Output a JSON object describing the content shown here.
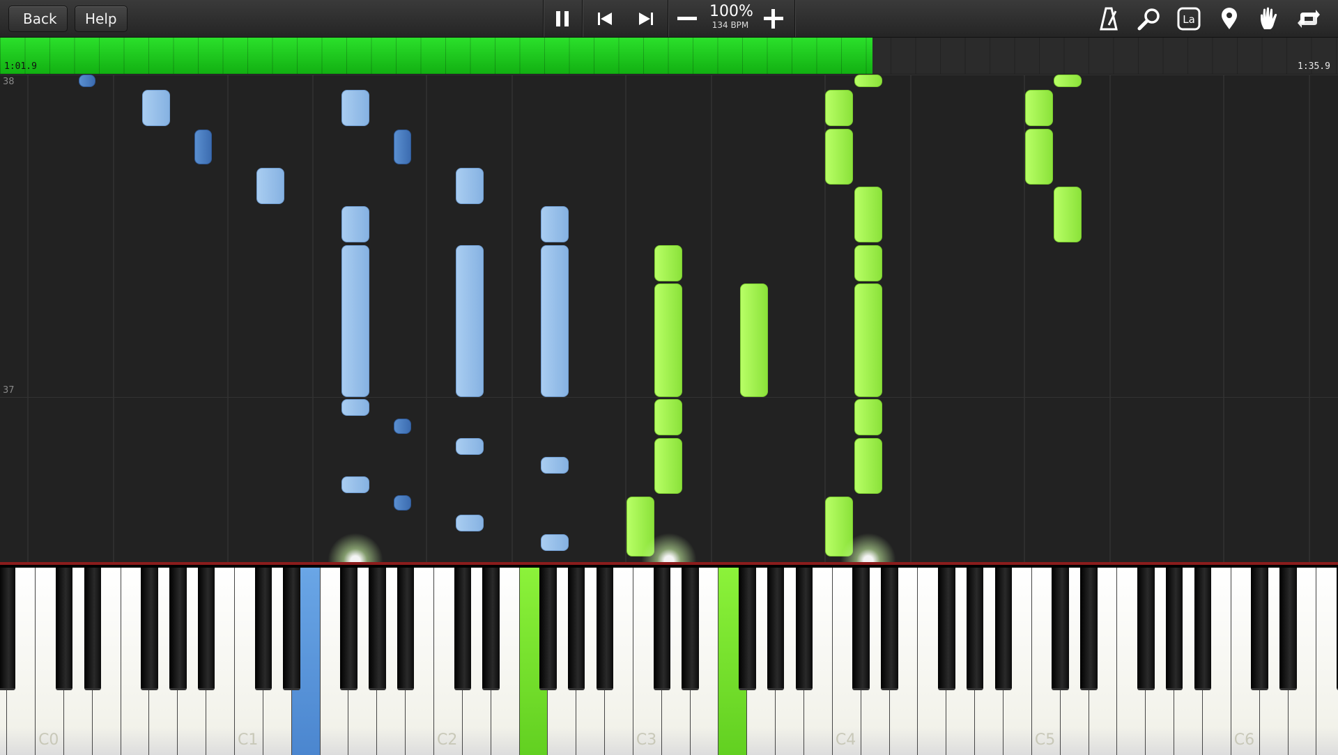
{
  "toolbar": {
    "back_label": "Back",
    "help_label": "Help",
    "speed_percent": "100%",
    "speed_bpm": "134 BPM",
    "icons": [
      "pause-icon",
      "skip-back-icon",
      "skip-forward-icon",
      "minus-icon",
      "plus-icon",
      "metronome-icon",
      "magnifier-icon",
      "note-label-icon",
      "location-pin-icon",
      "hand-icon",
      "loop-icon"
    ],
    "note_label_text": "La"
  },
  "progress": {
    "time_elapsed": "1:01.9",
    "time_total": "1:35.9",
    "fraction": 0.652,
    "fill_color": "#1dc41d"
  },
  "roll": {
    "measures": [
      "38",
      "37"
    ]
  },
  "keyboard": {
    "octave_labels": [
      "C0",
      "C1",
      "C2",
      "C3",
      "C4",
      "C5",
      "C6"
    ],
    "colors": {
      "left_hand": "#86b2e2",
      "right_hand": "#8be23a"
    }
  }
}
